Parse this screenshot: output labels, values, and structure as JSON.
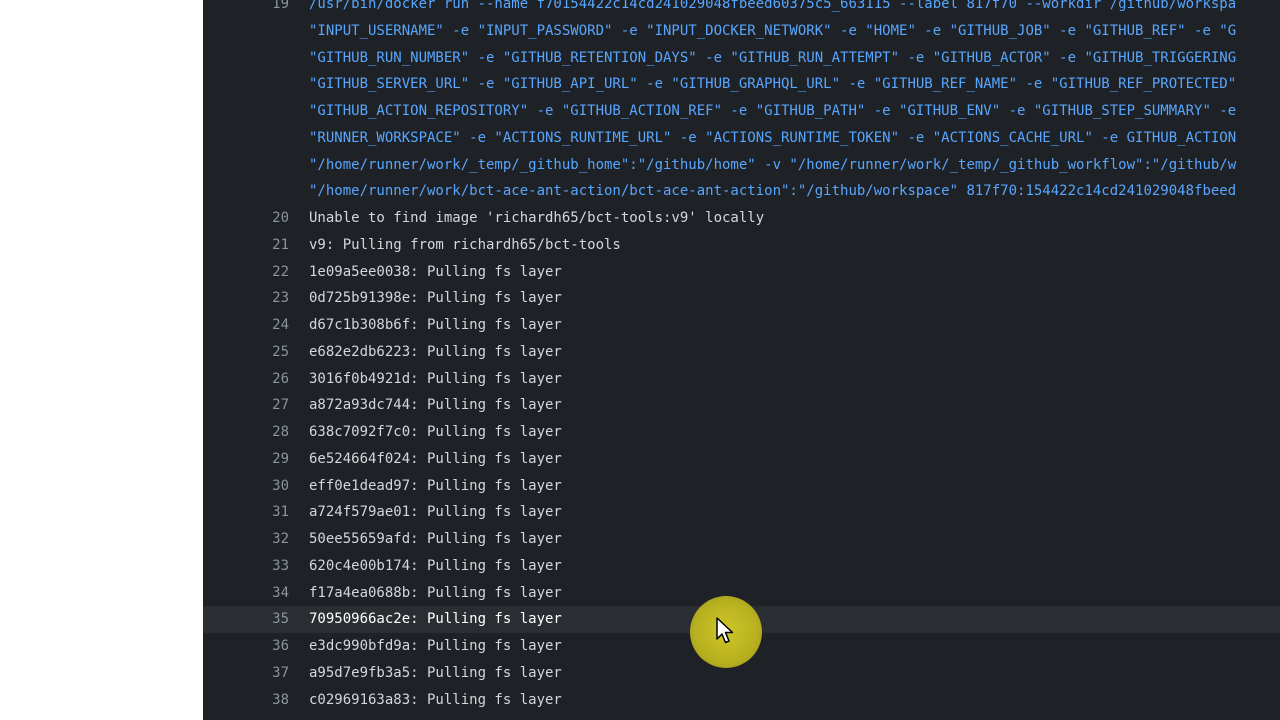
{
  "log": {
    "lines": [
      {
        "number": "19",
        "text": "/usr/bin/docker run --name f70154422c14cd241029048fbeed60375c5_663115 --label 817f70 --workdir /github/workspa",
        "kind": "cmd"
      },
      {
        "number": "",
        "text": "\"INPUT_USERNAME\" -e \"INPUT_PASSWORD\" -e \"INPUT_DOCKER_NETWORK\" -e \"HOME\" -e \"GITHUB_JOB\" -e \"GITHUB_REF\" -e \"G",
        "kind": "cmd"
      },
      {
        "number": "",
        "text": "\"GITHUB_RUN_NUMBER\" -e \"GITHUB_RETENTION_DAYS\" -e \"GITHUB_RUN_ATTEMPT\" -e \"GITHUB_ACTOR\" -e \"GITHUB_TRIGGERING",
        "kind": "cmd"
      },
      {
        "number": "",
        "text": "\"GITHUB_SERVER_URL\" -e \"GITHUB_API_URL\" -e \"GITHUB_GRAPHQL_URL\" -e \"GITHUB_REF_NAME\" -e \"GITHUB_REF_PROTECTED\"",
        "kind": "cmd"
      },
      {
        "number": "",
        "text": "\"GITHUB_ACTION_REPOSITORY\" -e \"GITHUB_ACTION_REF\" -e \"GITHUB_PATH\" -e \"GITHUB_ENV\" -e \"GITHUB_STEP_SUMMARY\" -e",
        "kind": "cmd"
      },
      {
        "number": "",
        "text": "\"RUNNER_WORKSPACE\" -e \"ACTIONS_RUNTIME_URL\" -e \"ACTIONS_RUNTIME_TOKEN\" -e \"ACTIONS_CACHE_URL\" -e GITHUB_ACTION",
        "kind": "cmd"
      },
      {
        "number": "",
        "text": "\"/home/runner/work/_temp/_github_home\":\"/github/home\" -v \"/home/runner/work/_temp/_github_workflow\":\"/github/w",
        "kind": "cmd"
      },
      {
        "number": "",
        "text": "\"/home/runner/work/bct-ace-ant-action/bct-ace-ant-action\":\"/github/workspace\" 817f70:154422c14cd241029048fbeed",
        "kind": "cmd"
      },
      {
        "number": "20",
        "text": "Unable to find image 'richardh65/bct-tools:v9' locally",
        "kind": "out"
      },
      {
        "number": "21",
        "text": "v9: Pulling from richardh65/bct-tools",
        "kind": "out"
      },
      {
        "number": "22",
        "text": "1e09a5ee0038: Pulling fs layer",
        "kind": "out"
      },
      {
        "number": "23",
        "text": "0d725b91398e: Pulling fs layer",
        "kind": "out"
      },
      {
        "number": "24",
        "text": "d67c1b308b6f: Pulling fs layer",
        "kind": "out"
      },
      {
        "number": "25",
        "text": "e682e2db6223: Pulling fs layer",
        "kind": "out"
      },
      {
        "number": "26",
        "text": "3016f0b4921d: Pulling fs layer",
        "kind": "out"
      },
      {
        "number": "27",
        "text": "a872a93dc744: Pulling fs layer",
        "kind": "out"
      },
      {
        "number": "28",
        "text": "638c7092f7c0: Pulling fs layer",
        "kind": "out"
      },
      {
        "number": "29",
        "text": "6e524664f024: Pulling fs layer",
        "kind": "out"
      },
      {
        "number": "30",
        "text": "eff0e1dead97: Pulling fs layer",
        "kind": "out"
      },
      {
        "number": "31",
        "text": "a724f579ae01: Pulling fs layer",
        "kind": "out"
      },
      {
        "number": "32",
        "text": "50ee55659afd: Pulling fs layer",
        "kind": "out"
      },
      {
        "number": "33",
        "text": "620c4e00b174: Pulling fs layer",
        "kind": "out"
      },
      {
        "number": "34",
        "text": "f17a4ea0688b: Pulling fs layer",
        "kind": "out"
      },
      {
        "number": "35",
        "text": "70950966ac2e: Pulling fs layer",
        "kind": "out",
        "highlighted": true
      },
      {
        "number": "36",
        "text": "e3dc990bfd9a: Pulling fs layer",
        "kind": "out"
      },
      {
        "number": "37",
        "text": "a95d7e9fb3a5: Pulling fs layer",
        "kind": "out"
      },
      {
        "number": "38",
        "text": "c02969163a83: Pulling fs layer",
        "kind": "out"
      }
    ]
  },
  "colors": {
    "log_background": "#1e2125",
    "command_text": "#58a6ff",
    "output_text": "#d4d7db",
    "line_number": "#8b949e",
    "highlight_row": "#2a2e33",
    "cursor_halo": "#d6ce28"
  },
  "cursor": {
    "icon": "mouse-pointer-icon"
  }
}
